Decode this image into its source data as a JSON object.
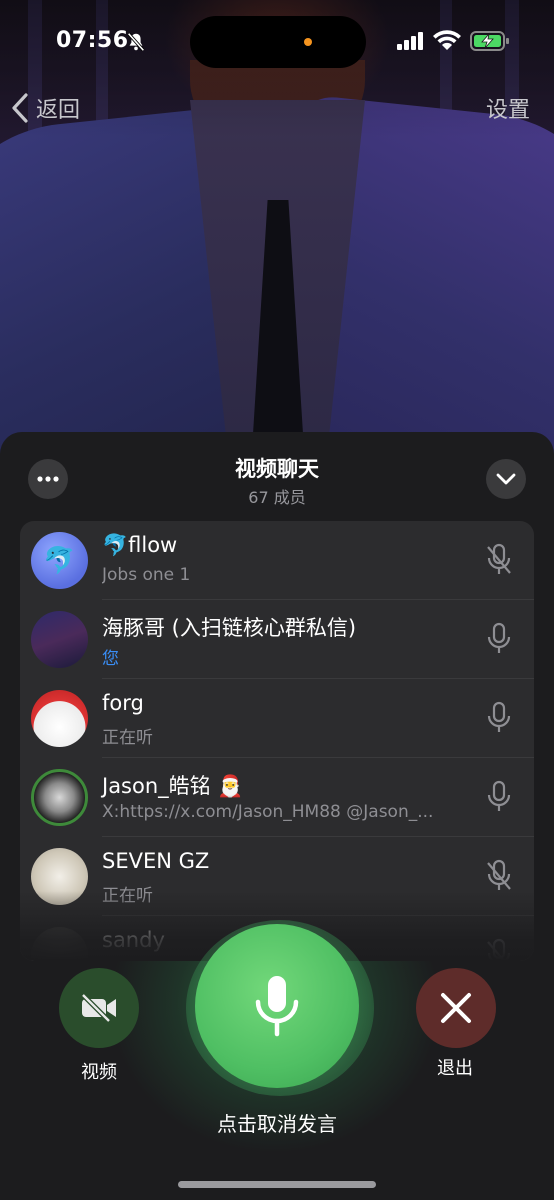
{
  "status_bar": {
    "time": "07:56"
  },
  "nav": {
    "back_label": "返回",
    "settings_label": "设置"
  },
  "panel": {
    "title": "视频聊天",
    "subtitle": "67 成员"
  },
  "participants": [
    {
      "name": "🐬fllow",
      "status": "Jobs one 1",
      "status_color": "#8e8e93",
      "mic": "muted"
    },
    {
      "name": "海豚哥 (入扫链核心群私信)",
      "status": "您",
      "status_color": "#3a8ef6",
      "mic": "on"
    },
    {
      "name": "forg",
      "status": "正在听",
      "status_color": "#8e8e93",
      "mic": "on"
    },
    {
      "name": "Jason_皓铭 🎅",
      "status": "X:https://x.com/Jason_HM88 @Jason_...",
      "status_color": "#8e8e93",
      "mic": "on"
    },
    {
      "name": "SEVEN GZ",
      "status": "正在听",
      "status_color": "#8e8e93",
      "mic": "muted"
    },
    {
      "name": "sandy",
      "status": "",
      "status_color": "#8e8e93",
      "mic": "muted"
    }
  ],
  "controls": {
    "video_label": "视频",
    "exit_label": "退出",
    "speak_label": "点击取消发言"
  },
  "colors": {
    "accent_green": "#4fbf63",
    "exit_red": "#5e2c2a",
    "video_green": "#2a4d2c",
    "link_blue": "#3a8ef6"
  },
  "icons": [
    "bell-off-icon",
    "signal-icon",
    "wifi-icon",
    "battery-charging-icon",
    "chevron-left-icon",
    "more-icon",
    "chevron-down-icon",
    "mic-icon",
    "mic-off-icon",
    "video-off-icon",
    "close-icon"
  ]
}
